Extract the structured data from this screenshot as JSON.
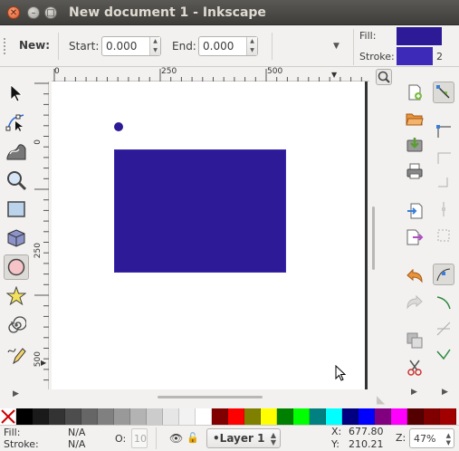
{
  "window": {
    "title": "New document 1 - Inkscape"
  },
  "controls": {
    "new_label": "New:",
    "start_label": "Start:",
    "start_value": "0.000",
    "end_label": "End:",
    "end_value": "0.000"
  },
  "style_indicator": {
    "fill_label": "Fill:",
    "stroke_label": "Stroke:",
    "stroke_width": "2",
    "fill_color": "#2c1a96",
    "stroke_color": "#3d2ab8"
  },
  "ruler": {
    "h_labels": [
      "0",
      "250",
      "500"
    ],
    "v_labels": [
      "0",
      "250",
      "500"
    ]
  },
  "tools": [
    "selector-icon",
    "node-icon",
    "tweak-icon",
    "zoom-icon",
    "rectangle-icon",
    "3dbox-icon",
    "ellipse-icon",
    "star-icon",
    "spiral-icon",
    "pencil-icon"
  ],
  "active_tool": "ellipse-icon",
  "canvas_objects": {
    "rect_color": "#2c1a96",
    "circle_color": "#2c1a96"
  },
  "palette": [
    "#000000",
    "#1a1a1a",
    "#333333",
    "#4d4d4d",
    "#666666",
    "#808080",
    "#999999",
    "#b3b3b3",
    "#cccccc",
    "#e6e6e6",
    "#f2f2f2",
    "#ffffff",
    "#800000",
    "#ff0000",
    "#808000",
    "#ffff00",
    "#008000",
    "#00ff00",
    "#008080",
    "#00ffff",
    "#000080",
    "#0000ff",
    "#800080",
    "#ff00ff",
    "#550000",
    "#800000",
    "#a00000"
  ],
  "status": {
    "fill_label": "Fill:",
    "fill_value": "N/A",
    "stroke_label": "Stroke:",
    "stroke_value": "N/A",
    "opacity_label": "O:",
    "opacity_value": "10",
    "layer": "•Layer 1",
    "x_label": "X:",
    "x_value": "677.80",
    "y_label": "Y:",
    "y_value": "210.21",
    "zoom_label": "Z:",
    "zoom_value": "47%"
  }
}
